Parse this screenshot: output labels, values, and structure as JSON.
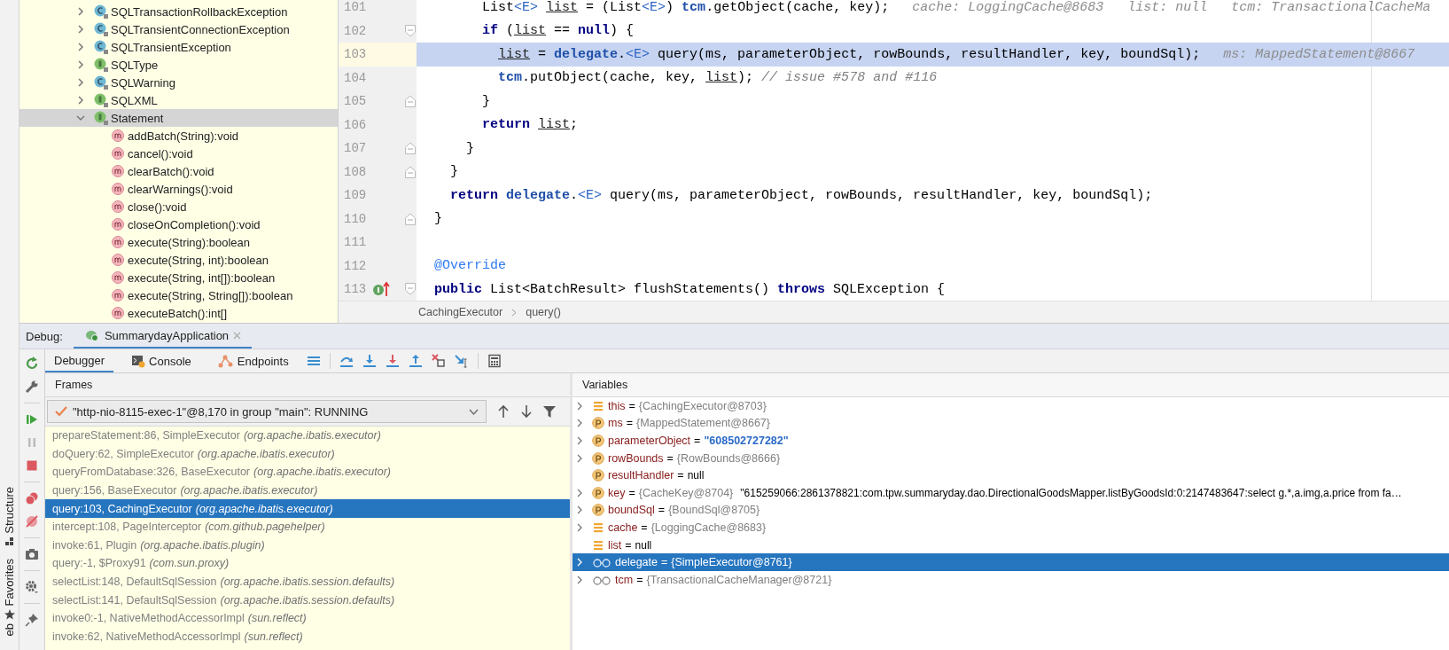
{
  "side_labels": [
    "Structure",
    "Favorites",
    "eb"
  ],
  "tree": {
    "items": [
      {
        "label": "SQLTransactionRollbackException",
        "kind": "class",
        "expanded": false,
        "selected": false
      },
      {
        "label": "SQLTransientConnectionException",
        "kind": "class",
        "expanded": false,
        "selected": false
      },
      {
        "label": "SQLTransientException",
        "kind": "class",
        "expanded": false,
        "selected": false
      },
      {
        "label": "SQLType",
        "kind": "interface",
        "expanded": false,
        "selected": false
      },
      {
        "label": "SQLWarning",
        "kind": "class",
        "expanded": false,
        "selected": false
      },
      {
        "label": "SQLXML",
        "kind": "interface",
        "expanded": false,
        "selected": false
      },
      {
        "label": "Statement",
        "kind": "interface",
        "expanded": true,
        "selected": true,
        "children": [
          {
            "label": "addBatch(String):void",
            "kind": "method",
            "selected": false
          },
          {
            "label": "cancel():void",
            "kind": "method",
            "selected": false
          },
          {
            "label": "clearBatch():void",
            "kind": "method",
            "selected": false
          },
          {
            "label": "clearWarnings():void",
            "kind": "method",
            "selected": false
          },
          {
            "label": "close():void",
            "kind": "method",
            "selected": false
          },
          {
            "label": "closeOnCompletion():void",
            "kind": "method",
            "selected": false
          },
          {
            "label": "execute(String):boolean",
            "kind": "method",
            "selected": false
          },
          {
            "label": "execute(String, int):boolean",
            "kind": "method",
            "selected": false
          },
          {
            "label": "execute(String, int[]):boolean",
            "kind": "method",
            "selected": false
          },
          {
            "label": "execute(String, String[]):boolean",
            "kind": "method",
            "selected": false
          },
          {
            "label": "executeBatch():int[]",
            "kind": "method",
            "selected": false
          }
        ]
      }
    ]
  },
  "editor": {
    "lines": [
      {
        "number": "101",
        "current": false,
        "tokens": [
          {
            "kind": "plain",
            "text": "      List"
          },
          {
            "kind": "generic",
            "text": "<E>"
          },
          {
            "kind": "local",
            "text": " list"
          },
          {
            "kind": "plain",
            "text": " = (List"
          },
          {
            "kind": "generic",
            "text": "<E>"
          },
          {
            "kind": "plain",
            "text": ") "
          },
          {
            "kind": "field",
            "text": "tcm"
          },
          {
            "kind": "plain",
            "text": ".getObject(cache, key);"
          }
        ],
        "hint": "cache: LoggingCache@8683   list: null   tcm: TransactionalCacheMa"
      },
      {
        "number": "102",
        "current": false,
        "fold_start": true,
        "tokens": [
          {
            "kind": "keyword",
            "text": "      if"
          },
          {
            "kind": "plain",
            "text": " ("
          },
          {
            "kind": "local",
            "text": "list"
          },
          {
            "kind": "plain",
            "text": " == "
          },
          {
            "kind": "keyword",
            "text": "null"
          },
          {
            "kind": "plain",
            "text": ") {"
          }
        ]
      },
      {
        "number": "103",
        "current": true,
        "tokens": [
          {
            "kind": "local",
            "text": "        list"
          },
          {
            "kind": "plain",
            "text": " = "
          },
          {
            "kind": "field",
            "text": "delegate"
          },
          {
            "kind": "plain",
            "text": "."
          },
          {
            "kind": "generic",
            "text": "<E>"
          },
          {
            "kind": "plain",
            "text": " query(ms, parameterObject, rowBounds, resultHandler, key, boundSql);"
          }
        ],
        "hint": "ms: MappedStatement@8667"
      },
      {
        "number": "104",
        "current": false,
        "tokens": [
          {
            "kind": "field",
            "text": "        tcm"
          },
          {
            "kind": "plain",
            "text": ".putObject(cache, key, "
          },
          {
            "kind": "local",
            "text": "list"
          },
          {
            "kind": "plain",
            "text": "); "
          },
          {
            "kind": "comment",
            "text": "// issue #578 and #116"
          }
        ]
      },
      {
        "number": "105",
        "current": false,
        "fold_end": true,
        "tokens": [
          {
            "kind": "plain",
            "text": "      }"
          }
        ]
      },
      {
        "number": "106",
        "current": false,
        "tokens": [
          {
            "kind": "keyword",
            "text": "      return"
          },
          {
            "kind": "local",
            "text": " list"
          },
          {
            "kind": "plain",
            "text": ";"
          }
        ]
      },
      {
        "number": "107",
        "current": false,
        "fold_end": true,
        "tokens": [
          {
            "kind": "plain",
            "text": "    }"
          }
        ]
      },
      {
        "number": "108",
        "current": false,
        "fold_end": true,
        "tokens": [
          {
            "kind": "plain",
            "text": "  }"
          }
        ]
      },
      {
        "number": "109",
        "current": false,
        "tokens": [
          {
            "kind": "keyword",
            "text": "  return"
          },
          {
            "kind": "field",
            "text": " delegate"
          },
          {
            "kind": "plain",
            "text": "."
          },
          {
            "kind": "generic",
            "text": "<E>"
          },
          {
            "kind": "plain",
            "text": " query(ms, parameterObject, rowBounds, resultHandler, key, boundSql);"
          }
        ]
      },
      {
        "number": "110",
        "current": false,
        "fold_end": true,
        "tokens": [
          {
            "kind": "plain",
            "text": "}"
          }
        ]
      },
      {
        "number": "111",
        "current": false
      },
      {
        "number": "112",
        "current": false,
        "tokens": [
          {
            "kind": "annotation",
            "text": "@Override"
          }
        ]
      },
      {
        "number": "113",
        "current": false,
        "fold_start": true,
        "implements_marker": true,
        "tokens": [
          {
            "kind": "keyword",
            "text": "public"
          },
          {
            "kind": "plain",
            "text": " List<BatchResult> flushStatements() "
          },
          {
            "kind": "keyword",
            "text": "throws"
          },
          {
            "kind": "plain",
            "text": " SQLException {"
          }
        ]
      }
    ],
    "breadcrumb": [
      "CachingExecutor",
      "query()"
    ]
  },
  "debug": {
    "label": "Debug:",
    "tabs": [
      {
        "label": "SummarydayApplication",
        "selected": true
      }
    ],
    "toolbar_tabs": [
      {
        "label": "Debugger",
        "kind": "plain",
        "selected": true
      },
      {
        "label": "Console",
        "kind": "console",
        "selected": false
      },
      {
        "label": "Endpoints",
        "kind": "endpoints",
        "selected": false
      }
    ],
    "frames": {
      "title": "Frames",
      "thread": "\"http-nio-8115-exec-1\"@8,170 in group \"main\": RUNNING",
      "items": [
        {
          "method": "prepareStatement:86, SimpleExecutor",
          "package": "(org.apache.ibatis.executor)",
          "selected": false
        },
        {
          "method": "doQuery:62, SimpleExecutor",
          "package": "(org.apache.ibatis.executor)",
          "selected": false
        },
        {
          "method": "queryFromDatabase:326, BaseExecutor",
          "package": "(org.apache.ibatis.executor)",
          "selected": false
        },
        {
          "method": "query:156, BaseExecutor",
          "package": "(org.apache.ibatis.executor)",
          "selected": false
        },
        {
          "method": "query:103, CachingExecutor",
          "package": "(org.apache.ibatis.executor)",
          "selected": true
        },
        {
          "method": "intercept:108, PageInterceptor",
          "package": "(com.github.pagehelper)",
          "selected": false
        },
        {
          "method": "invoke:61, Plugin",
          "package": "(org.apache.ibatis.plugin)",
          "selected": false
        },
        {
          "method": "query:-1, $Proxy91",
          "package": "(com.sun.proxy)",
          "selected": false
        },
        {
          "method": "selectList:148, DefaultSqlSession",
          "package": "(org.apache.ibatis.session.defaults)",
          "selected": false
        },
        {
          "method": "selectList:141, DefaultSqlSession",
          "package": "(org.apache.ibatis.session.defaults)",
          "selected": false
        },
        {
          "method": "invoke0:-1, NativeMethodAccessorImpl",
          "package": "(sun.reflect)",
          "selected": false
        },
        {
          "method": "invoke:62, NativeMethodAccessorImpl",
          "package": "(sun.reflect)",
          "selected": false
        }
      ]
    },
    "variables": {
      "title": "Variables",
      "items": [
        {
          "name": "this",
          "operator": "=",
          "kind": "field",
          "expandable": true,
          "selected": false,
          "type": "{CachingExecutor@8703}"
        },
        {
          "name": "ms",
          "operator": "=",
          "kind": "param",
          "expandable": true,
          "selected": false,
          "type": "{MappedStatement@8667}"
        },
        {
          "name": "parameterObject",
          "operator": "=",
          "kind": "param",
          "expandable": true,
          "selected": false,
          "value": {
            "kind": "string",
            "text": "\"608502727282\""
          }
        },
        {
          "name": "rowBounds",
          "operator": "=",
          "kind": "param",
          "expandable": true,
          "selected": false,
          "type": "{RowBounds@8666}"
        },
        {
          "name": "resultHandler",
          "operator": "=",
          "kind": "param",
          "expandable": false,
          "selected": false,
          "value": {
            "kind": "text",
            "text": "null"
          }
        },
        {
          "name": "key",
          "operator": "=",
          "kind": "param",
          "expandable": true,
          "selected": false,
          "type": "{CacheKey@8704}",
          "value": {
            "kind": "text",
            "text": "\"615259066:2861378821:com.tpw.summaryday.dao.DirectionalGoodsMapper.listByGoodsId:0:2147483647:select g.*,a.img,a.price from fa…"
          }
        },
        {
          "name": "boundSql",
          "operator": "=",
          "kind": "param",
          "expandable": true,
          "selected": false,
          "type": "{BoundSql@8705}"
        },
        {
          "name": "cache",
          "operator": "=",
          "kind": "field",
          "expandable": true,
          "selected": false,
          "type": "{LoggingCache@8683}"
        },
        {
          "name": "list",
          "operator": "=",
          "kind": "field",
          "expandable": false,
          "selected": false,
          "value": {
            "kind": "text",
            "text": "null"
          }
        },
        {
          "name": "delegate",
          "operator": "=",
          "kind": "watch",
          "expandable": true,
          "selected": true,
          "type": "{SimpleExecutor@8761}"
        },
        {
          "name": "tcm",
          "operator": "=",
          "kind": "watch",
          "expandable": true,
          "selected": false,
          "type": "{TransactionalCacheManager@8721}"
        }
      ]
    }
  }
}
